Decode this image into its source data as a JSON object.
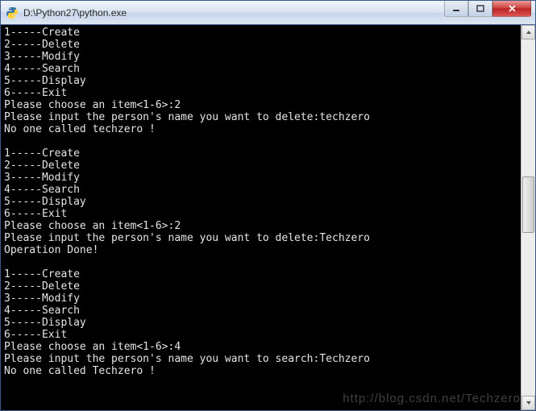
{
  "window": {
    "title": "D:\\Python27\\python.exe",
    "icon_name": "python-icon"
  },
  "controls": {
    "minimize_tip": "Minimize",
    "maximize_tip": "Maximize",
    "close_tip": "Close"
  },
  "menu_items": [
    "1-----Create",
    "2-----Delete",
    "3-----Modify",
    "4-----Search",
    "5-----Display",
    "6-----Exit"
  ],
  "sessions": [
    {
      "prompt_choice": "Please choose an item<1-6>:",
      "choice": "2",
      "prompt_name": "Please input the person's name you want to delete:",
      "input_name": "techzero",
      "result": "No one called techzero !"
    },
    {
      "prompt_choice": "Please choose an item<1-6>:",
      "choice": "2",
      "prompt_name": "Please input the person's name you want to delete:",
      "input_name": "Techzero",
      "result": "Operation Done!"
    },
    {
      "prompt_choice": "Please choose an item<1-6>:",
      "choice": "4",
      "prompt_name": "Please input the person's name you want to search:",
      "input_name": "Techzero",
      "result": "No one called Techzero !"
    }
  ],
  "watermark": "http://blog.csdn.net/Techzero",
  "colors": {
    "console_bg": "#000000",
    "console_fg": "#e5e5e5",
    "close_btn": "#c8403a"
  }
}
